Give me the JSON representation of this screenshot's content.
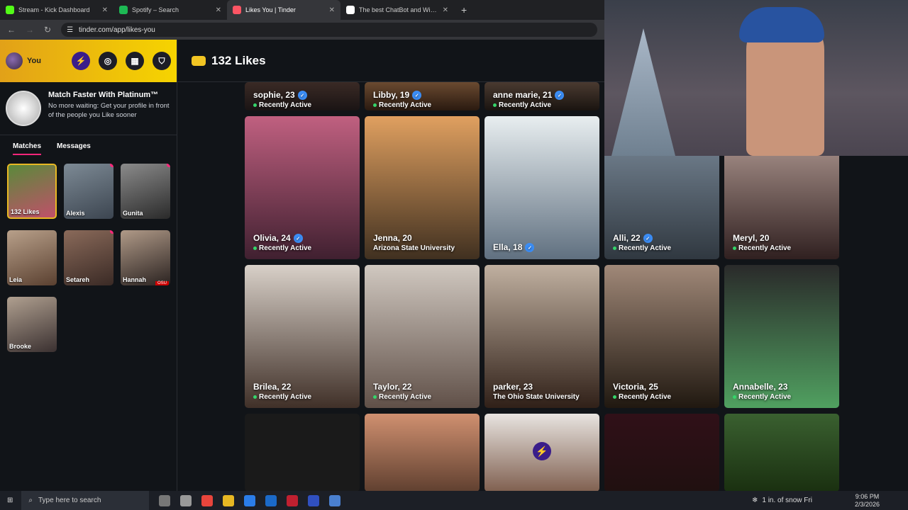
{
  "browser": {
    "tabs": [
      {
        "label": "Stream - Kick Dashboard",
        "color": "#53fc18",
        "active": false
      },
      {
        "label": "Spotify – Search",
        "color": "#1db954",
        "active": false
      },
      {
        "label": "Likes You | Tinder",
        "color": "#fd5564",
        "active": true
      },
      {
        "label": "The best ChatBot and Widgets",
        "color": "#ffffff",
        "active": false
      }
    ],
    "new_tab": "+",
    "url": "tinder.com/app/likes-you"
  },
  "sidebar": {
    "profile_label": "You",
    "promo_title": "Match Faster With Platinum™",
    "promo_text": "No more waiting: Get your profile in front of the people you Like sooner",
    "tabs": [
      "Matches",
      "Messages"
    ],
    "matches": [
      {
        "name": "132 Likes",
        "bg": "linear-gradient(160deg,#5a8a3a,#c0506a)"
      },
      {
        "name": "Alexis",
        "bg": "linear-gradient(160deg,#7d8a95,#3c4550)"
      },
      {
        "name": "Gunita",
        "bg": "linear-gradient(160deg,#8b8b8b,#2a2a2a)"
      },
      {
        "name": "Leia",
        "bg": "linear-gradient(160deg,#b8a08a,#5a4030)"
      },
      {
        "name": "Setareh",
        "bg": "linear-gradient(160deg,#8a6a5a,#3a2a25)"
      },
      {
        "name": "Hannah",
        "bg": "linear-gradient(160deg,#b09a88,#2a2220)",
        "badge": "OSU"
      },
      {
        "name": "Brooke",
        "bg": "linear-gradient(160deg,#b0a090,#3a3030)"
      }
    ]
  },
  "main": {
    "title": "132 Likes",
    "cards": [
      {
        "name": "sophie, 23",
        "sub": "Recently Active",
        "verified": true,
        "active": true
      },
      {
        "name": "Libby, 19",
        "sub": "Recently Active",
        "verified": true,
        "active": true
      },
      {
        "name": "anne marie, 21",
        "sub": "Recently Active",
        "verified": true,
        "active": true
      },
      {
        "name": "Olivia, 24",
        "sub": "Recently Active",
        "verified": true,
        "active": true
      },
      {
        "name": "Jenna, 20",
        "sub": "Arizona State University",
        "verified": false,
        "active": false
      },
      {
        "name": "Ella, 18",
        "sub": "",
        "verified": true,
        "active": false
      },
      {
        "name": "Alli, 22",
        "sub": "Recently Active",
        "verified": true,
        "active": true
      },
      {
        "name": "Meryl, 20",
        "sub": "Recently Active",
        "verified": false,
        "active": true
      },
      {
        "name": "Brilea, 22",
        "sub": "Recently Active",
        "verified": false,
        "active": true
      },
      {
        "name": "Taylor, 22",
        "sub": "Recently Active",
        "verified": false,
        "active": true
      },
      {
        "name": "parker, 23",
        "sub": "The Ohio State University",
        "verified": false,
        "active": false
      },
      {
        "name": "Victoria, 25",
        "sub": "Recently Active",
        "verified": false,
        "active": true
      },
      {
        "name": "Annabelle, 23",
        "sub": "Recently Active",
        "verified": false,
        "active": true
      }
    ]
  },
  "taskbar": {
    "search_placeholder": "Type here to search",
    "weather": "1 in. of snow Fri",
    "time": "9:06 PM",
    "date": "2/3/2026"
  }
}
